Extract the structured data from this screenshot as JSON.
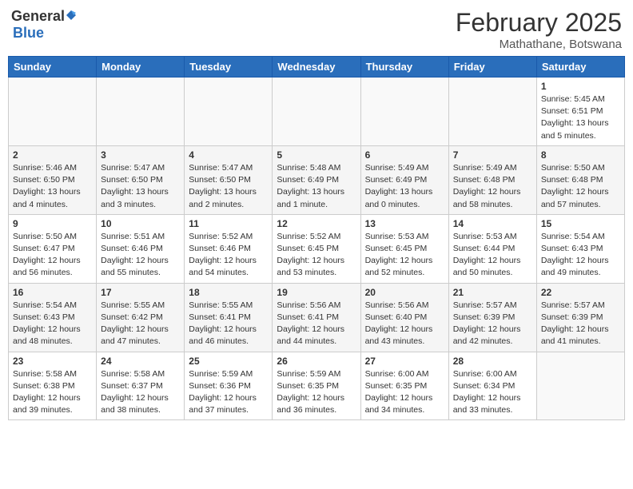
{
  "header": {
    "logo_general": "General",
    "logo_blue": "Blue",
    "month_year": "February 2025",
    "location": "Mathathane, Botswana"
  },
  "days_of_week": [
    "Sunday",
    "Monday",
    "Tuesday",
    "Wednesday",
    "Thursday",
    "Friday",
    "Saturday"
  ],
  "weeks": [
    [
      {
        "day": "",
        "info": ""
      },
      {
        "day": "",
        "info": ""
      },
      {
        "day": "",
        "info": ""
      },
      {
        "day": "",
        "info": ""
      },
      {
        "day": "",
        "info": ""
      },
      {
        "day": "",
        "info": ""
      },
      {
        "day": "1",
        "info": "Sunrise: 5:45 AM\nSunset: 6:51 PM\nDaylight: 13 hours\nand 5 minutes."
      }
    ],
    [
      {
        "day": "2",
        "info": "Sunrise: 5:46 AM\nSunset: 6:50 PM\nDaylight: 13 hours\nand 4 minutes."
      },
      {
        "day": "3",
        "info": "Sunrise: 5:47 AM\nSunset: 6:50 PM\nDaylight: 13 hours\nand 3 minutes."
      },
      {
        "day": "4",
        "info": "Sunrise: 5:47 AM\nSunset: 6:50 PM\nDaylight: 13 hours\nand 2 minutes."
      },
      {
        "day": "5",
        "info": "Sunrise: 5:48 AM\nSunset: 6:49 PM\nDaylight: 13 hours\nand 1 minute."
      },
      {
        "day": "6",
        "info": "Sunrise: 5:49 AM\nSunset: 6:49 PM\nDaylight: 13 hours\nand 0 minutes."
      },
      {
        "day": "7",
        "info": "Sunrise: 5:49 AM\nSunset: 6:48 PM\nDaylight: 12 hours\nand 58 minutes."
      },
      {
        "day": "8",
        "info": "Sunrise: 5:50 AM\nSunset: 6:48 PM\nDaylight: 12 hours\nand 57 minutes."
      }
    ],
    [
      {
        "day": "9",
        "info": "Sunrise: 5:50 AM\nSunset: 6:47 PM\nDaylight: 12 hours\nand 56 minutes."
      },
      {
        "day": "10",
        "info": "Sunrise: 5:51 AM\nSunset: 6:46 PM\nDaylight: 12 hours\nand 55 minutes."
      },
      {
        "day": "11",
        "info": "Sunrise: 5:52 AM\nSunset: 6:46 PM\nDaylight: 12 hours\nand 54 minutes."
      },
      {
        "day": "12",
        "info": "Sunrise: 5:52 AM\nSunset: 6:45 PM\nDaylight: 12 hours\nand 53 minutes."
      },
      {
        "day": "13",
        "info": "Sunrise: 5:53 AM\nSunset: 6:45 PM\nDaylight: 12 hours\nand 52 minutes."
      },
      {
        "day": "14",
        "info": "Sunrise: 5:53 AM\nSunset: 6:44 PM\nDaylight: 12 hours\nand 50 minutes."
      },
      {
        "day": "15",
        "info": "Sunrise: 5:54 AM\nSunset: 6:43 PM\nDaylight: 12 hours\nand 49 minutes."
      }
    ],
    [
      {
        "day": "16",
        "info": "Sunrise: 5:54 AM\nSunset: 6:43 PM\nDaylight: 12 hours\nand 48 minutes."
      },
      {
        "day": "17",
        "info": "Sunrise: 5:55 AM\nSunset: 6:42 PM\nDaylight: 12 hours\nand 47 minutes."
      },
      {
        "day": "18",
        "info": "Sunrise: 5:55 AM\nSunset: 6:41 PM\nDaylight: 12 hours\nand 46 minutes."
      },
      {
        "day": "19",
        "info": "Sunrise: 5:56 AM\nSunset: 6:41 PM\nDaylight: 12 hours\nand 44 minutes."
      },
      {
        "day": "20",
        "info": "Sunrise: 5:56 AM\nSunset: 6:40 PM\nDaylight: 12 hours\nand 43 minutes."
      },
      {
        "day": "21",
        "info": "Sunrise: 5:57 AM\nSunset: 6:39 PM\nDaylight: 12 hours\nand 42 minutes."
      },
      {
        "day": "22",
        "info": "Sunrise: 5:57 AM\nSunset: 6:39 PM\nDaylight: 12 hours\nand 41 minutes."
      }
    ],
    [
      {
        "day": "23",
        "info": "Sunrise: 5:58 AM\nSunset: 6:38 PM\nDaylight: 12 hours\nand 39 minutes."
      },
      {
        "day": "24",
        "info": "Sunrise: 5:58 AM\nSunset: 6:37 PM\nDaylight: 12 hours\nand 38 minutes."
      },
      {
        "day": "25",
        "info": "Sunrise: 5:59 AM\nSunset: 6:36 PM\nDaylight: 12 hours\nand 37 minutes."
      },
      {
        "day": "26",
        "info": "Sunrise: 5:59 AM\nSunset: 6:35 PM\nDaylight: 12 hours\nand 36 minutes."
      },
      {
        "day": "27",
        "info": "Sunrise: 6:00 AM\nSunset: 6:35 PM\nDaylight: 12 hours\nand 34 minutes."
      },
      {
        "day": "28",
        "info": "Sunrise: 6:00 AM\nSunset: 6:34 PM\nDaylight: 12 hours\nand 33 minutes."
      },
      {
        "day": "",
        "info": ""
      }
    ]
  ]
}
